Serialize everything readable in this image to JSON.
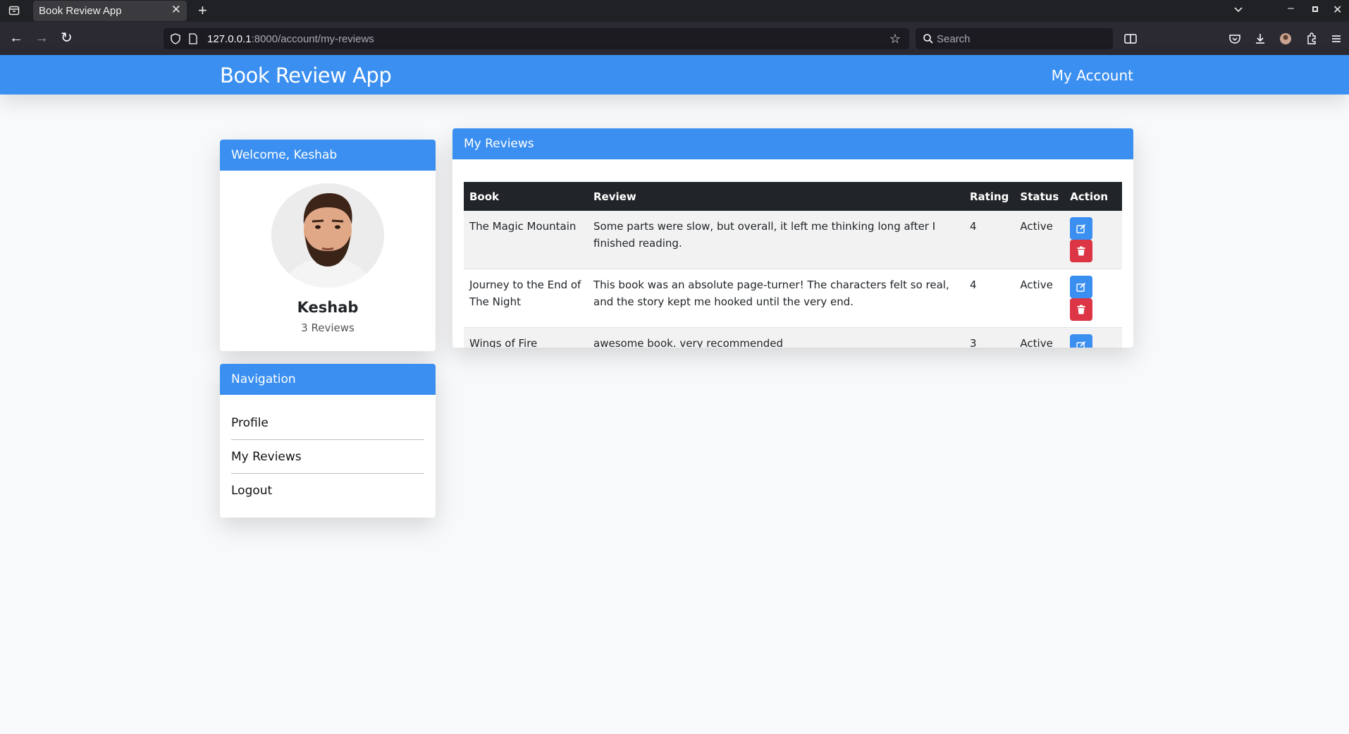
{
  "browser": {
    "tab_title": "Book Review App",
    "url_host": "127.0.0.1",
    "url_rest": ":8000/account/my-reviews",
    "search_placeholder": "Search"
  },
  "header": {
    "brand": "Book Review App",
    "account_link": "My Account"
  },
  "welcome": {
    "title": "Welcome, Keshab",
    "user_name": "Keshab",
    "review_count": "3 Reviews"
  },
  "navigation": {
    "title": "Navigation",
    "items": [
      {
        "label": "Profile"
      },
      {
        "label": "My Reviews"
      },
      {
        "label": "Logout"
      }
    ]
  },
  "reviews": {
    "title": "My Reviews",
    "columns": [
      "Book",
      "Review",
      "Rating",
      "Status",
      "Action"
    ],
    "rows": [
      {
        "book": "The Magic Mountain",
        "review": "Some parts were slow, but overall, it left me thinking long after I finished reading.",
        "rating": "4",
        "status": "Active"
      },
      {
        "book": "Journey to the End of The Night",
        "review": "This book was an absolute page-turner! The characters felt so real, and the story kept me hooked until the very end.",
        "rating": "4",
        "status": "Active"
      },
      {
        "book": "Wings of Fire",
        "review": "awesome book. very recommended",
        "rating": "3",
        "status": "Active"
      }
    ]
  },
  "colors": {
    "primary": "#3b8ff0",
    "danger": "#dc3545",
    "success": "#198754",
    "table_header": "#212529"
  }
}
